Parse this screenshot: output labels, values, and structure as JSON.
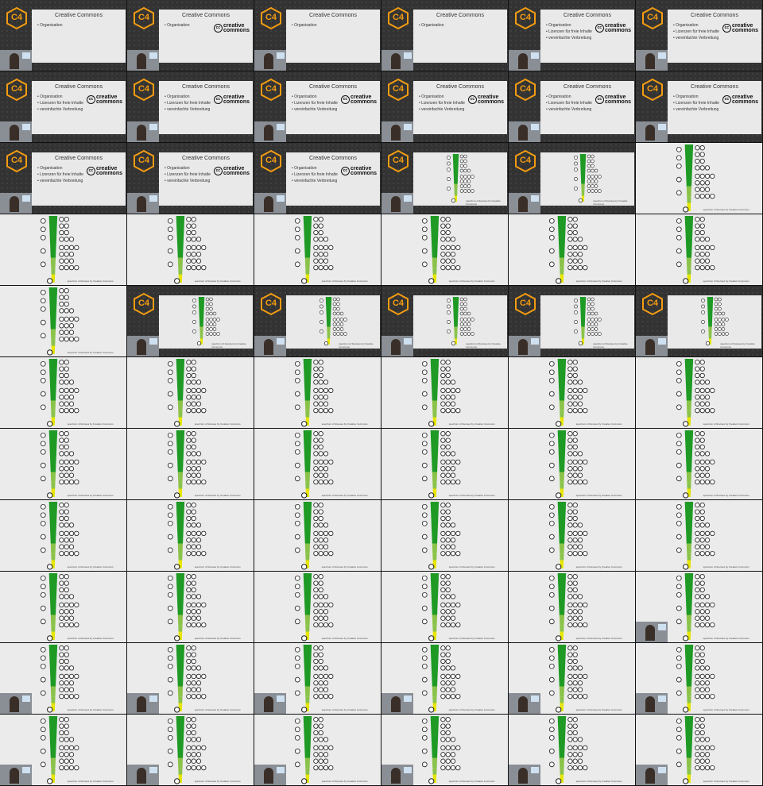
{
  "slide": {
    "title": "Creative Commons",
    "bullets": [
      "Organisation",
      "Lizenzen für freie Inhalte",
      "vereinfachte Verbreitung"
    ],
    "cc_logo": {
      "mark": "cc",
      "line1": "creative",
      "line2": "commons"
    },
    "conference_logo": "C4",
    "footer_note": "spectrum of licenses by Creative Commons"
  },
  "colors": {
    "studio_bg": "#333333",
    "slide_bg": "#e9e9e9",
    "logo_orange": "#f39c12",
    "green_dark": "#1f9a25",
    "green_light": "#8bc34a",
    "yellow": "#e6e600"
  },
  "frames": [
    {
      "layout": "title",
      "bullets": 1,
      "cam": true
    },
    {
      "layout": "title",
      "bullets": 1,
      "cam": true
    },
    {
      "layout": "title",
      "bullets": 1,
      "cam": true
    },
    {
      "layout": "title",
      "bullets": 1,
      "cam": true
    },
    {
      "layout": "title",
      "bullets": 3,
      "cam": true
    },
    {
      "layout": "title",
      "bullets": 3,
      "cam": true
    },
    {
      "layout": "title",
      "bullets": 3,
      "cam": true
    },
    {
      "layout": "title",
      "bullets": 3,
      "cam": true
    },
    {
      "layout": "title",
      "bullets": 3,
      "cam": true
    },
    {
      "layout": "title",
      "bullets": 3,
      "cam": true
    },
    {
      "layout": "title",
      "bullets": 3,
      "cam": true
    },
    {
      "layout": "title",
      "bullets": 3,
      "cam": true
    },
    {
      "layout": "title",
      "bullets": 3,
      "cam": true
    },
    {
      "layout": "title",
      "bullets": 3,
      "cam": true
    },
    {
      "layout": "title",
      "bullets": 3,
      "cam": true
    },
    {
      "layout": "spectrum-studio",
      "cam": true
    },
    {
      "layout": "spectrum-studio",
      "cam": true
    },
    {
      "layout": "spectrum-full",
      "cam": false
    },
    {
      "layout": "spectrum-full",
      "cam": false
    },
    {
      "layout": "spectrum-full",
      "cam": false
    },
    {
      "layout": "spectrum-full",
      "cam": false
    },
    {
      "layout": "spectrum-full",
      "cam": false
    },
    {
      "layout": "spectrum-full",
      "cam": false
    },
    {
      "layout": "spectrum-full",
      "cam": false
    },
    {
      "layout": "spectrum-full",
      "cam": false
    },
    {
      "layout": "spectrum-studio",
      "cam": true
    },
    {
      "layout": "spectrum-studio",
      "cam": true
    },
    {
      "layout": "spectrum-studio",
      "cam": true
    },
    {
      "layout": "spectrum-studio",
      "cam": true
    },
    {
      "layout": "spectrum-studio",
      "cam": true
    },
    {
      "layout": "spectrum-full",
      "cam": false
    },
    {
      "layout": "spectrum-full",
      "cam": false
    },
    {
      "layout": "spectrum-full",
      "cam": false
    },
    {
      "layout": "spectrum-full",
      "cam": false
    },
    {
      "layout": "spectrum-full",
      "cam": false
    },
    {
      "layout": "spectrum-full",
      "cam": false
    },
    {
      "layout": "spectrum-full",
      "cam": false
    },
    {
      "layout": "spectrum-full",
      "cam": false
    },
    {
      "layout": "spectrum-full",
      "cam": false
    },
    {
      "layout": "spectrum-full",
      "cam": false
    },
    {
      "layout": "spectrum-full",
      "cam": false
    },
    {
      "layout": "spectrum-full",
      "cam": false
    },
    {
      "layout": "spectrum-full",
      "cam": false
    },
    {
      "layout": "spectrum-full",
      "cam": false
    },
    {
      "layout": "spectrum-full",
      "cam": false
    },
    {
      "layout": "spectrum-full",
      "cam": false
    },
    {
      "layout": "spectrum-full",
      "cam": false
    },
    {
      "layout": "spectrum-full",
      "cam": false
    },
    {
      "layout": "spectrum-full",
      "cam": false
    },
    {
      "layout": "spectrum-full",
      "cam": false
    },
    {
      "layout": "spectrum-full",
      "cam": false
    },
    {
      "layout": "spectrum-full",
      "cam": false
    },
    {
      "layout": "spectrum-full",
      "cam": false
    },
    {
      "layout": "spectrum-full",
      "cam": true
    },
    {
      "layout": "spectrum-full",
      "cam": true
    },
    {
      "layout": "spectrum-full",
      "cam": true
    },
    {
      "layout": "spectrum-full",
      "cam": true
    },
    {
      "layout": "spectrum-full",
      "cam": true
    },
    {
      "layout": "spectrum-full",
      "cam": true
    },
    {
      "layout": "spectrum-full",
      "cam": true
    },
    {
      "layout": "spectrum-full",
      "cam": true
    },
    {
      "layout": "spectrum-full",
      "cam": true
    },
    {
      "layout": "spectrum-full",
      "cam": true
    },
    {
      "layout": "spectrum-full",
      "cam": true
    },
    {
      "layout": "spectrum-full",
      "cam": true
    },
    {
      "layout": "spectrum-full",
      "cam": true
    }
  ]
}
